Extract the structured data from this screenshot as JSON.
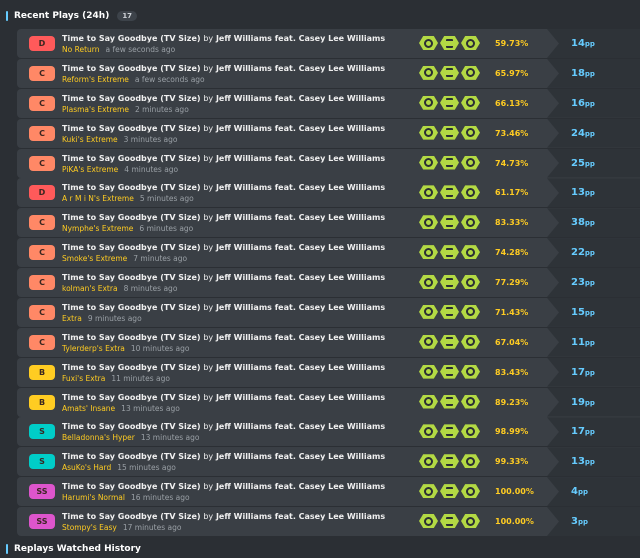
{
  "header": {
    "title": "Recent Plays (24h)",
    "count": "17"
  },
  "footer": {
    "title": "Replays Watched History"
  },
  "song": {
    "title": "Time to Say Goodbye (TV Size)",
    "by": "by",
    "artist": "Jeff Williams feat. Casey Lee Williams"
  },
  "pp_unit": "pp",
  "grade_colors": {
    "D": "#ff5a5a",
    "C": "#ff8866",
    "B": "#ffcc22",
    "S": "#00cdc8",
    "SS": "#dd55cc"
  },
  "mod_color": "#b3d944",
  "mods": [
    "no-fail-icon",
    "hourglass-icon",
    "circle-target-icon"
  ],
  "plays": [
    {
      "grade": "D",
      "difficulty": "No Return",
      "time": "a few seconds ago",
      "accuracy": "59.73%",
      "pp": "14"
    },
    {
      "grade": "C",
      "difficulty": "Reform's Extreme",
      "time": "a few seconds ago",
      "accuracy": "65.97%",
      "pp": "18"
    },
    {
      "grade": "C",
      "difficulty": "Plasma's Extreme",
      "time": "2 minutes ago",
      "accuracy": "66.13%",
      "pp": "16"
    },
    {
      "grade": "C",
      "difficulty": "Kuki's Extreme",
      "time": "3 minutes ago",
      "accuracy": "73.46%",
      "pp": "24"
    },
    {
      "grade": "C",
      "difficulty": "PiKA's Extreme",
      "time": "4 minutes ago",
      "accuracy": "74.73%",
      "pp": "25"
    },
    {
      "grade": "D",
      "difficulty": "A r M i N's Extreme",
      "time": "5 minutes ago",
      "accuracy": "61.17%",
      "pp": "13"
    },
    {
      "grade": "C",
      "difficulty": "Nymphe's Extreme",
      "time": "6 minutes ago",
      "accuracy": "83.33%",
      "pp": "38"
    },
    {
      "grade": "C",
      "difficulty": "Smoke's Extreme",
      "time": "7 minutes ago",
      "accuracy": "74.28%",
      "pp": "22"
    },
    {
      "grade": "C",
      "difficulty": "kolman's Extra",
      "time": "8 minutes ago",
      "accuracy": "77.29%",
      "pp": "23"
    },
    {
      "grade": "C",
      "difficulty": "Extra",
      "time": "9 minutes ago",
      "accuracy": "71.43%",
      "pp": "15"
    },
    {
      "grade": "C",
      "difficulty": "Tylerderp's Extra",
      "time": "10 minutes ago",
      "accuracy": "67.04%",
      "pp": "11"
    },
    {
      "grade": "B",
      "difficulty": "Fuxi's Extra",
      "time": "11 minutes ago",
      "accuracy": "83.43%",
      "pp": "17"
    },
    {
      "grade": "B",
      "difficulty": "Amats' Insane",
      "time": "13 minutes ago",
      "accuracy": "89.23%",
      "pp": "19"
    },
    {
      "grade": "S",
      "difficulty": "Belladonna's Hyper",
      "time": "13 minutes ago",
      "accuracy": "98.99%",
      "pp": "17"
    },
    {
      "grade": "S",
      "difficulty": "AsuKo's Hard",
      "time": "15 minutes ago",
      "accuracy": "99.33%",
      "pp": "13"
    },
    {
      "grade": "SS",
      "difficulty": "Harumi's Normal",
      "time": "16 minutes ago",
      "accuracy": "100.00%",
      "pp": "4"
    },
    {
      "grade": "SS",
      "difficulty": "Stompy's Easy",
      "time": "17 minutes ago",
      "accuracy": "100.00%",
      "pp": "3"
    }
  ]
}
